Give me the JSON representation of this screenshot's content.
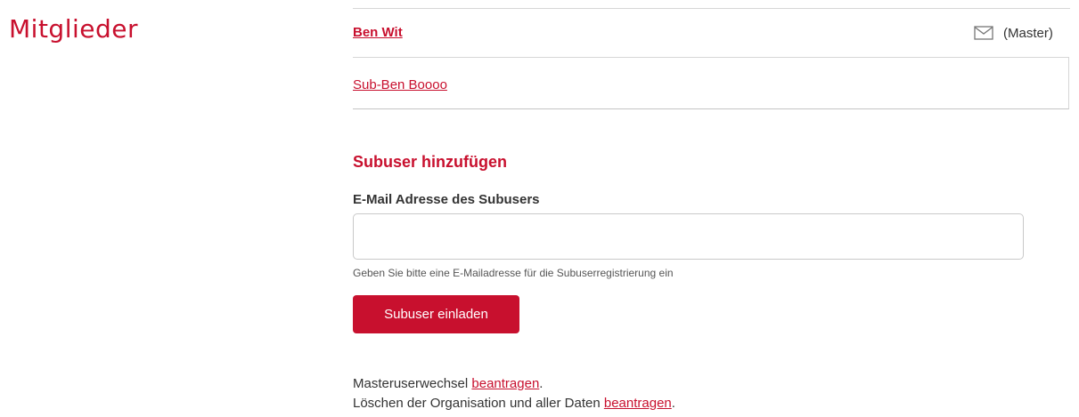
{
  "page_title": "Mitglieder",
  "members": {
    "master": {
      "name": "Ben Wit",
      "icon": "envelope-icon",
      "badge": "(Master)"
    },
    "subusers": [
      {
        "name": "Sub-Ben Boooo"
      }
    ]
  },
  "add_subuser": {
    "heading": "Subuser hinzufügen",
    "email_label": "E-Mail Adresse des Subusers",
    "email_value": "",
    "email_placeholder": "",
    "help_text": "Geben Sie bitte eine E-Mailadresse für die Subuserregistrierung ein",
    "button_label": "Subuser einladen"
  },
  "footer": {
    "master_change_text": "Masteruserwechsel",
    "master_change_link": "beantragen",
    "master_change_suffix": ".",
    "delete_text": "Löschen der Organisation und aller Daten",
    "delete_link": "beantragen",
    "delete_suffix": "."
  },
  "colors": {
    "accent": "#c8102e",
    "text": "#333333",
    "border": "#d6d6d6"
  }
}
